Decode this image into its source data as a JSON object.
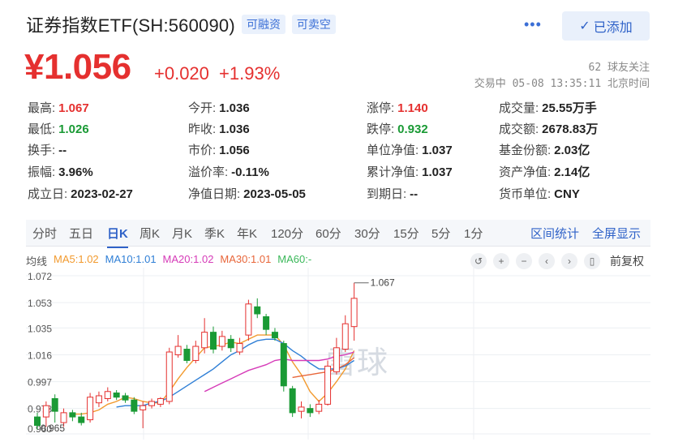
{
  "header": {
    "title": "证券指数ETF(SH:560090)",
    "tag_margin": "可融资",
    "tag_short": "可卖空",
    "more": "•••",
    "added_label": "已添加"
  },
  "quote": {
    "price": "¥1.056",
    "change": "+0.020",
    "change_pct": "+1.93%",
    "followers": "62 球友关注",
    "trade_status": "交易中 05-08 13:35:11 北京时间"
  },
  "stats": {
    "high_label": "最高:",
    "high": "1.067",
    "low_label": "最低:",
    "low": "1.026",
    "turnover_label": "换手:",
    "turnover": "--",
    "amplitude_label": "振幅:",
    "amplitude": "3.96%",
    "listed_label": "成立日:",
    "listed": "2023-02-27",
    "open_label": "今开:",
    "open": "1.036",
    "prev_label": "昨收:",
    "prev": "1.036",
    "mkt_label": "市价:",
    "mkt": "1.056",
    "premium_label": "溢价率:",
    "premium": "-0.11%",
    "navdate_label": "净值日期:",
    "navdate": "2023-05-05",
    "limitup_label": "涨停:",
    "limitup": "1.140",
    "limitdown_label": "跌停:",
    "limitdown": "0.932",
    "unitnav_label": "单位净值:",
    "unitnav": "1.037",
    "accnav_label": "累计净值:",
    "accnav": "1.037",
    "expiry_label": "到期日:",
    "expiry": "--",
    "volume_label": "成交量:",
    "volume": "25.55万手",
    "amount_label": "成交额:",
    "amount": "2678.83万",
    "shares_label": "基金份额:",
    "shares": "2.03亿",
    "assets_label": "资产净值:",
    "assets": "2.14亿",
    "currency_label": "货币单位:",
    "currency": "CNY"
  },
  "tabs": {
    "items": [
      "分时",
      "五日",
      "日K",
      "周K",
      "月K",
      "季K",
      "年K",
      "120分",
      "60分",
      "30分",
      "15分",
      "5分",
      "1分"
    ],
    "active": "日K",
    "interval_stats": "区间统计",
    "fullscreen": "全屏显示"
  },
  "legend": {
    "ma_label": "均线",
    "ma5": "MA5:1.02",
    "ma10": "MA10:1.01",
    "ma20": "MA20:1.02",
    "ma30": "MA30:1.01",
    "ma60": "MA60:-",
    "restore": "前复权"
  },
  "colors": {
    "up": "#e5302f",
    "down": "#1a9a35",
    "ma5": "#f29a2e",
    "ma10": "#2f7fd6",
    "ma20": "#d63bb8",
    "ma30": "#e8663a",
    "ma60": "#3bb85a"
  },
  "chart_data": {
    "type": "candlestick",
    "y_ticks": [
      "1.072",
      "1.053",
      "1.035",
      "1.016",
      "0.997",
      "0.978",
      "0.960"
    ],
    "ylim": [
      0.96,
      1.072
    ],
    "max_label": "1.067",
    "min_label": "0.965",
    "watermark": "雪球",
    "candles": [
      {
        "o": 0.972,
        "c": 0.966,
        "h": 0.975,
        "l": 0.963
      },
      {
        "o": 0.972,
        "c": 0.98,
        "h": 0.983,
        "l": 0.965
      },
      {
        "o": 0.985,
        "c": 0.976,
        "h": 0.988,
        "l": 0.968
      },
      {
        "o": 0.968,
        "c": 0.975,
        "h": 0.978,
        "l": 0.965
      },
      {
        "o": 0.975,
        "c": 0.972,
        "h": 0.977,
        "l": 0.969
      },
      {
        "o": 0.972,
        "c": 0.968,
        "h": 0.975,
        "l": 0.966
      },
      {
        "o": 0.97,
        "c": 0.986,
        "h": 0.989,
        "l": 0.968
      },
      {
        "o": 0.982,
        "c": 0.987,
        "h": 0.99,
        "l": 0.979
      },
      {
        "o": 0.985,
        "c": 0.99,
        "h": 0.993,
        "l": 0.983
      },
      {
        "o": 0.989,
        "c": 0.986,
        "h": 0.991,
        "l": 0.984
      },
      {
        "o": 0.987,
        "c": 0.984,
        "h": 0.989,
        "l": 0.982
      },
      {
        "o": 0.984,
        "c": 0.976,
        "h": 0.986,
        "l": 0.974
      },
      {
        "o": 0.977,
        "c": 0.98,
        "h": 0.983,
        "l": 0.964
      },
      {
        "o": 0.98,
        "c": 0.983,
        "h": 0.985,
        "l": 0.978
      },
      {
        "o": 0.981,
        "c": 0.985,
        "h": 0.986,
        "l": 0.979
      },
      {
        "o": 0.983,
        "c": 1.018,
        "h": 1.021,
        "l": 0.981
      },
      {
        "o": 1.016,
        "c": 1.022,
        "h": 1.03,
        "l": 1.014
      },
      {
        "o": 1.02,
        "c": 1.012,
        "h": 1.023,
        "l": 1.01
      },
      {
        "o": 1.012,
        "c": 1.022,
        "h": 1.026,
        "l": 1.01
      },
      {
        "o": 1.021,
        "c": 1.032,
        "h": 1.042,
        "l": 1.017
      },
      {
        "o": 1.032,
        "c": 1.02,
        "h": 1.036,
        "l": 1.017
      },
      {
        "o": 1.022,
        "c": 1.029,
        "h": 1.033,
        "l": 1.019
      },
      {
        "o": 1.027,
        "c": 1.021,
        "h": 1.03,
        "l": 1.018
      },
      {
        "o": 1.018,
        "c": 1.024,
        "h": 1.028,
        "l": 1.016
      },
      {
        "o": 1.03,
        "c": 1.052,
        "h": 1.055,
        "l": 1.026
      },
      {
        "o": 1.05,
        "c": 1.045,
        "h": 1.056,
        "l": 1.042
      },
      {
        "o": 1.043,
        "c": 1.034,
        "h": 1.045,
        "l": 1.03
      },
      {
        "o": 1.032,
        "c": 1.028,
        "h": 1.035,
        "l": 1.026
      },
      {
        "o": 1.024,
        "c": 0.994,
        "h": 1.026,
        "l": 0.99
      },
      {
        "o": 0.992,
        "c": 0.975,
        "h": 0.994,
        "l": 0.972
      },
      {
        "o": 0.976,
        "c": 0.979,
        "h": 0.983,
        "l": 0.971
      },
      {
        "o": 0.978,
        "c": 0.975,
        "h": 0.981,
        "l": 0.972
      },
      {
        "o": 0.976,
        "c": 0.981,
        "h": 0.984,
        "l": 0.974
      },
      {
        "o": 0.981,
        "c": 1.008,
        "h": 1.012,
        "l": 0.98
      },
      {
        "o": 1.004,
        "c": 1.021,
        "h": 1.028,
        "l": 1.002
      },
      {
        "o": 1.02,
        "c": 1.038,
        "h": 1.044,
        "l": 1.018
      },
      {
        "o": 1.036,
        "c": 1.056,
        "h": 1.067,
        "l": 1.026
      }
    ],
    "ma5": [
      null,
      null,
      null,
      null,
      0.974,
      0.974,
      0.975,
      0.977,
      0.981,
      0.983,
      0.986,
      0.985,
      0.983,
      0.982,
      0.982,
      0.99,
      0.999,
      1.007,
      1.014,
      1.021,
      1.022,
      1.023,
      1.025,
      1.024,
      1.027,
      1.03,
      1.03,
      1.03,
      1.023,
      1.011,
      1.002,
      0.99,
      0.983,
      0.989,
      0.997,
      1.006,
      1.019
    ],
    "ma10": [
      null,
      null,
      null,
      null,
      null,
      null,
      null,
      null,
      null,
      0.979,
      0.98,
      0.98,
      0.98,
      0.982,
      0.983,
      0.986,
      0.99,
      0.994,
      0.998,
      1.002,
      1.006,
      1.011,
      1.016,
      1.019,
      1.023,
      1.026,
      1.027,
      1.027,
      1.024,
      1.019,
      1.015,
      1.01,
      1.006,
      1.006,
      1.006,
      1.008,
      1.012
    ],
    "ma20": [
      null,
      null,
      null,
      null,
      null,
      null,
      null,
      null,
      null,
      null,
      null,
      null,
      null,
      null,
      null,
      null,
      null,
      null,
      null,
      0.99,
      0.993,
      0.996,
      0.999,
      1.002,
      1.005,
      1.007,
      1.009,
      1.012,
      1.013,
      1.012,
      1.012,
      1.012,
      1.012,
      1.013,
      1.015,
      1.016,
      1.018
    ],
    "ma30": [
      null,
      null,
      null,
      null,
      null,
      null,
      null,
      null,
      null,
      null,
      null,
      null,
      null,
      null,
      null,
      null,
      null,
      null,
      null,
      null,
      null,
      null,
      null,
      null,
      null,
      null,
      null,
      null,
      null,
      1.0,
      1.001,
      1.002,
      1.003,
      1.004,
      1.006,
      1.009,
      1.014
    ]
  }
}
